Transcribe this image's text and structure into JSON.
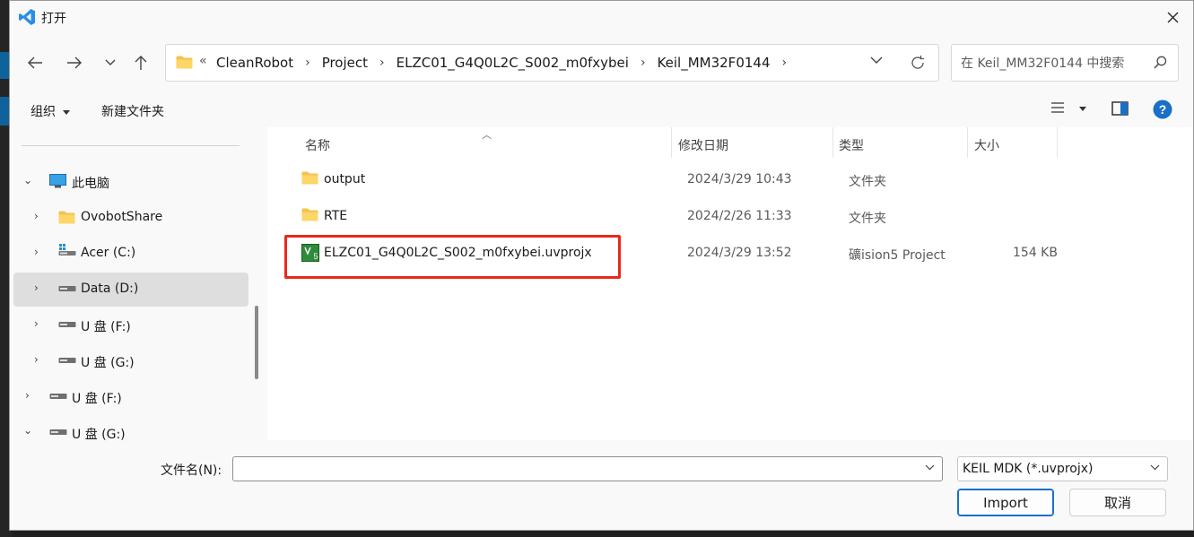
{
  "window": {
    "title": "打开"
  },
  "address": {
    "overflow": "«",
    "crumbs": [
      "CleanRobot",
      "Project",
      "ELZC01_G4Q0L2C_S002_m0fxybei",
      "Keil_MM32F0144"
    ]
  },
  "search": {
    "placeholder": "在 Keil_MM32F0144 中搜索"
  },
  "toolbar": {
    "organize": "组织",
    "new_folder": "新建文件夹"
  },
  "nav": {
    "this_pc": "此电脑",
    "items": [
      "OvobotShare",
      "Acer (C:)",
      "Data (D:)",
      "U 盘 (F:)",
      "U 盘 (G:)"
    ],
    "roots": [
      "U 盘 (F:)",
      "U 盘 (G:)"
    ]
  },
  "columns": {
    "name": "名称",
    "modified": "修改日期",
    "type": "类型",
    "size": "大小"
  },
  "files": [
    {
      "name": "output",
      "modified": "2024/3/29 10:43",
      "type": "文件夹",
      "size": ""
    },
    {
      "name": "RTE",
      "modified": "2024/2/26 11:33",
      "type": "文件夹",
      "size": ""
    },
    {
      "name": "ELZC01_G4Q0L2C_S002_m0fxybei.uvprojx",
      "modified": "2024/3/29 13:52",
      "type": "礦ision5 Project",
      "size": "154 KB"
    }
  ],
  "footer": {
    "filename_label": "文件名(N):",
    "filename_value": "",
    "filter": "KEIL MDK (*.uvprojx)",
    "import_label": "Import",
    "cancel_label": "取消"
  },
  "colors": {
    "accent": "#1a6fc8",
    "highlight": "#e8291b",
    "folder": "#f5c24c",
    "vscode_blue": "#2a8ee6"
  }
}
